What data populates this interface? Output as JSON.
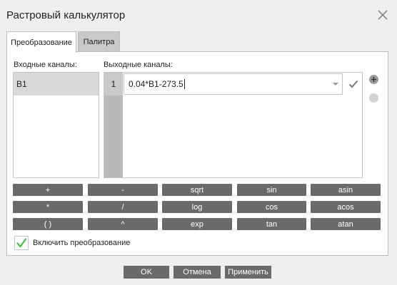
{
  "dialog": {
    "title": "Растровый калькулятор"
  },
  "tabs": [
    {
      "label": "Преобразование",
      "active": true
    },
    {
      "label": "Палитра",
      "active": false
    }
  ],
  "inputs": {
    "label": "Входные каналы:",
    "items": [
      "B1"
    ]
  },
  "outputs": {
    "label": "Выходные каналы:",
    "rows": [
      {
        "index": "1",
        "expression": "0.04*B1-273.5"
      }
    ]
  },
  "operators": [
    [
      "+",
      "-",
      "sqrt",
      "sin",
      "asin"
    ],
    [
      "*",
      "/",
      "log",
      "cos",
      "acos"
    ],
    [
      "( )",
      "^",
      "exp",
      "tan",
      "atan"
    ]
  ],
  "enable_transform": {
    "label": "Включить преобразование",
    "checked": true
  },
  "footer": {
    "ok": "OK",
    "cancel": "Отмена",
    "apply": "Применить"
  },
  "colors": {
    "button_bg": "#6a6a6a",
    "check_green": "#3cc43c",
    "active_row": "#d9d9d9"
  },
  "icons": {
    "close": "close-icon",
    "dropdown": "chevron-down-icon",
    "apply": "checkmark-icon",
    "add": "plus-circle-icon",
    "remove": "minus-circle-icon"
  }
}
